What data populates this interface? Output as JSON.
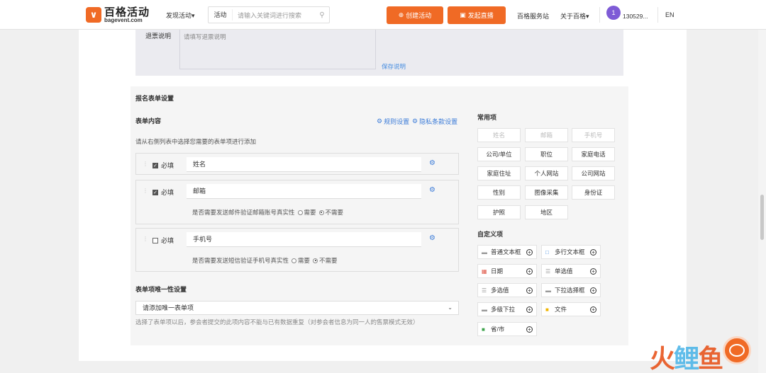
{
  "header": {
    "logo_icon": "∨",
    "logo_title": "百格活动",
    "logo_domain": "bagevent.com",
    "discover": "发现活动▾",
    "search_category": "活动",
    "search_placeholder": "请输入关键词进行搜索",
    "create_button": "创建活动",
    "live_button": "发起直播",
    "service_link": "百格服务站",
    "about_link": "关于百格▾",
    "avatar_text": "1",
    "username": "130529...",
    "lang": "EN",
    "accent_color": "#f06a25"
  },
  "refund": {
    "label": "退票说明",
    "placeholder": "请填写退票说明",
    "save_link": "保存说明"
  },
  "form_settings": {
    "section_title": "报名表单设置",
    "content_title": "表单内容",
    "rules_link": "规则设置",
    "privacy_link": "隐私条款设置",
    "hint": "请从右侧列表中选择您需要的表单项进行添加",
    "required_label": "必填",
    "fields": [
      {
        "name": "姓名",
        "required": true
      },
      {
        "name": "邮箱",
        "required": true,
        "question": "是否需要发送邮件验证邮箱账号真实性",
        "opt_yes": "需要",
        "opt_no": "不需要"
      },
      {
        "name": "手机号",
        "required": false,
        "question": "是否需要发送短信验证手机号真实性",
        "opt_yes": "需要",
        "opt_no": "不需要"
      }
    ],
    "unique_title": "表单项唯一性设置",
    "unique_select": "请添加唯一表单项",
    "unique_hint": "选择了表单项以后，参会者提交的此项内容不能与已有数据重复（对参会者信息为同一人的售票模式无效）"
  },
  "common_items": {
    "title": "常用项",
    "items": [
      "姓名",
      "邮箱",
      "手机号",
      "公司/单位",
      "职位",
      "家庭电话",
      "家庭住址",
      "个人网站",
      "公司网站",
      "性别",
      "图像采集",
      "身份证",
      "护照",
      "地区"
    ]
  },
  "custom_items": {
    "title": "自定义项",
    "items": [
      "普通文本框",
      "多行文本框",
      "日期",
      "单选值",
      "多选值",
      "下拉选择框",
      "多级下拉",
      "文件",
      "省/市"
    ]
  },
  "watermark": {
    "text_a": "火",
    "text_b": "鲤",
    "text_c": "鱼"
  }
}
